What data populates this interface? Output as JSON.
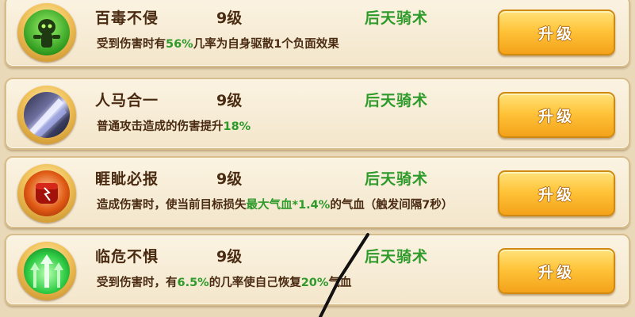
{
  "skills": [
    {
      "icon": "poison-immunity-icon",
      "name": "百毒不侵",
      "level": "9级",
      "type": "后天骑术",
      "desc": [
        {
          "t": "受到伤害时有",
          "hl": false
        },
        {
          "t": "56%",
          "hl": true
        },
        {
          "t": "几率为自身驱散1个负面效果",
          "hl": false
        }
      ],
      "button": "升级"
    },
    {
      "icon": "blade-slash-icon",
      "name": "人马合一",
      "level": "9级",
      "type": "后天骑术",
      "desc": [
        {
          "t": "普通攻击造成的伤害提升",
          "hl": false
        },
        {
          "t": "18%",
          "hl": true
        }
      ],
      "button": "升级"
    },
    {
      "icon": "fist-strike-icon",
      "name": "睚眦必报",
      "level": "9级",
      "type": "后天骑术",
      "desc": [
        {
          "t": "造成伤害时，使当前目标损失",
          "hl": false
        },
        {
          "t": "最大气血*1.4%",
          "hl": true
        },
        {
          "t": "的气血（触发间隔7秒）",
          "hl": false
        }
      ],
      "button": "升级"
    },
    {
      "icon": "healing-arrows-icon",
      "name": "临危不惧",
      "level": "9级",
      "type": "后天骑术",
      "desc": [
        {
          "t": "受到伤害时，有",
          "hl": false
        },
        {
          "t": "6.5%",
          "hl": true
        },
        {
          "t": "的几率使自己恢复",
          "hl": false
        },
        {
          "t": "20%",
          "hl": true
        },
        {
          "t": "气血",
          "hl": false
        }
      ],
      "button": "升级"
    }
  ],
  "colors": {
    "highlight": "#2e9a2a",
    "text": "#4a2b12",
    "button": "#ffc43a"
  }
}
